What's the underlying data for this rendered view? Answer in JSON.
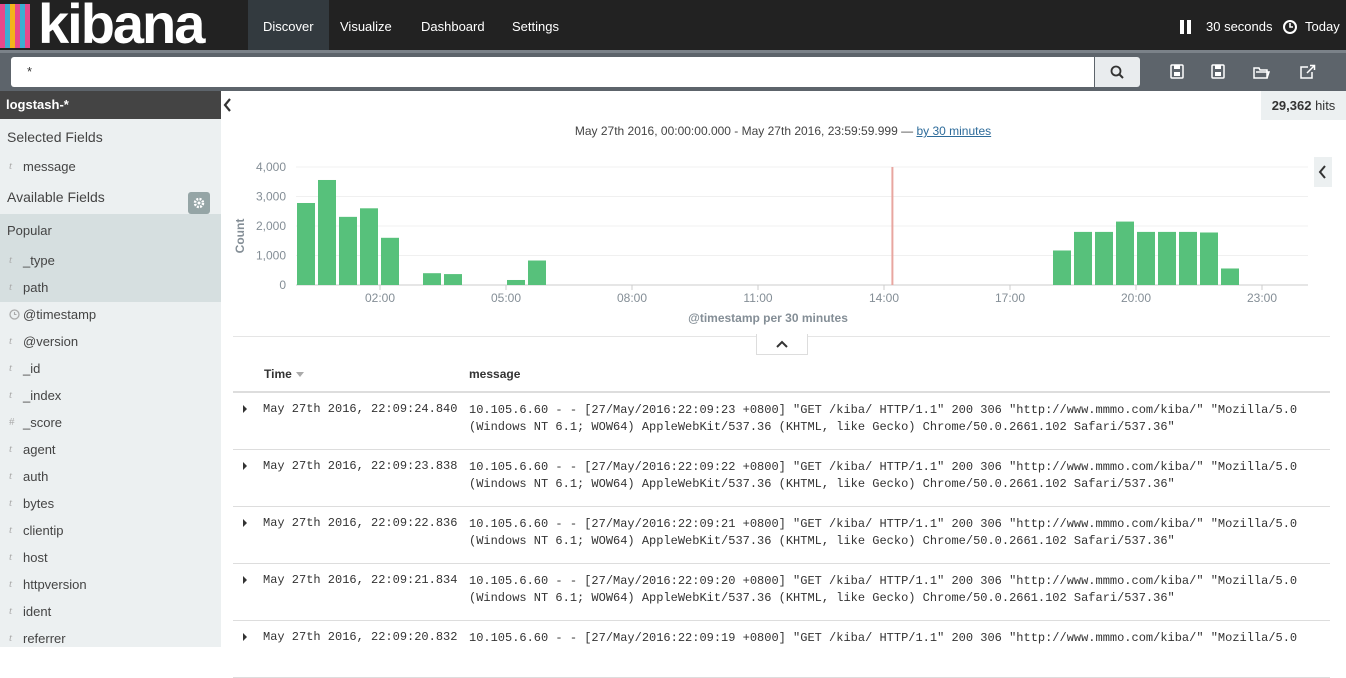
{
  "app": {
    "name": "kibana"
  },
  "nav": {
    "tabs": [
      {
        "label": "Discover",
        "active": true
      },
      {
        "label": "Visualize",
        "active": false
      },
      {
        "label": "Dashboard",
        "active": false
      },
      {
        "label": "Settings",
        "active": false
      }
    ],
    "refresh_interval": "30 seconds",
    "time_range": "Today"
  },
  "search": {
    "query": "*"
  },
  "sidebar": {
    "index_pattern": "logstash-*",
    "selected_title": "Selected Fields",
    "selected_fields": [
      {
        "type": "t",
        "name": "message"
      }
    ],
    "available_title": "Available Fields",
    "popular_title": "Popular",
    "popular_fields": [
      {
        "type": "t",
        "name": "_type"
      },
      {
        "type": "t",
        "name": "path"
      }
    ],
    "fields": [
      {
        "type": "clock",
        "name": "@timestamp"
      },
      {
        "type": "t",
        "name": "@version"
      },
      {
        "type": "t",
        "name": "_id"
      },
      {
        "type": "t",
        "name": "_index"
      },
      {
        "type": "#",
        "name": "_score"
      },
      {
        "type": "t",
        "name": "agent"
      },
      {
        "type": "t",
        "name": "auth"
      },
      {
        "type": "t",
        "name": "bytes"
      },
      {
        "type": "t",
        "name": "clientip"
      },
      {
        "type": "t",
        "name": "host"
      },
      {
        "type": "t",
        "name": "httpversion"
      },
      {
        "type": "t",
        "name": "ident"
      },
      {
        "type": "t",
        "name": "referrer"
      }
    ]
  },
  "hits": {
    "count": "29,362",
    "label": "hits"
  },
  "date_range": {
    "text": "May 27th 2016, 00:00:00.000 - May 27th 2016, 23:59:59.999 —",
    "interval_link": "by 30 minutes"
  },
  "chart_data": {
    "type": "bar",
    "ylabel": "Count",
    "xlabel": "@timestamp per 30 minutes",
    "ylim": [
      0,
      4000
    ],
    "y_ticks": [
      "0",
      "1,000",
      "2,000",
      "3,000",
      "4,000"
    ],
    "x_ticks": [
      {
        "label": "02:00",
        "hour": 2
      },
      {
        "label": "05:00",
        "hour": 5
      },
      {
        "label": "08:00",
        "hour": 8
      },
      {
        "label": "11:00",
        "hour": 11
      },
      {
        "label": "14:00",
        "hour": 14
      },
      {
        "label": "17:00",
        "hour": 17
      },
      {
        "label": "20:00",
        "hour": 20
      },
      {
        "label": "23:00",
        "hour": 23
      }
    ],
    "bar_color": "#57c17b",
    "marker_color": "#e8a6a0",
    "current_time_hour": 14.2,
    "bars": [
      {
        "start_hour": 0.0,
        "value": 2780
      },
      {
        "start_hour": 0.5,
        "value": 3560
      },
      {
        "start_hour": 1.0,
        "value": 2310
      },
      {
        "start_hour": 1.5,
        "value": 2600
      },
      {
        "start_hour": 2.0,
        "value": 1600
      },
      {
        "start_hour": 3.0,
        "value": 400
      },
      {
        "start_hour": 3.5,
        "value": 370
      },
      {
        "start_hour": 5.0,
        "value": 170
      },
      {
        "start_hour": 5.5,
        "value": 830
      },
      {
        "start_hour": 18.0,
        "value": 1170
      },
      {
        "start_hour": 18.5,
        "value": 1800
      },
      {
        "start_hour": 19.0,
        "value": 1800
      },
      {
        "start_hour": 19.5,
        "value": 2150
      },
      {
        "start_hour": 20.0,
        "value": 1800
      },
      {
        "start_hour": 20.5,
        "value": 1800
      },
      {
        "start_hour": 21.0,
        "value": 1800
      },
      {
        "start_hour": 21.5,
        "value": 1780
      },
      {
        "start_hour": 22.0,
        "value": 560
      }
    ]
  },
  "table": {
    "columns": [
      "Time",
      "message"
    ],
    "rows": [
      {
        "time": "May 27th 2016, 22:09:24.840",
        "message": "10.105.6.60 - - [27/May/2016:22:09:23 +0800] \"GET /kiba/ HTTP/1.1\" 200 306 \"http://www.mmmo.com/kiba/\" \"Mozilla/5.0 (Windows NT 6.1; WOW64) AppleWebKit/537.36 (KHTML, like Gecko) Chrome/50.0.2661.102 Safari/537.36\""
      },
      {
        "time": "May 27th 2016, 22:09:23.838",
        "message": "10.105.6.60 - - [27/May/2016:22:09:22 +0800] \"GET /kiba/ HTTP/1.1\" 200 306 \"http://www.mmmo.com/kiba/\" \"Mozilla/5.0 (Windows NT 6.1; WOW64) AppleWebKit/537.36 (KHTML, like Gecko) Chrome/50.0.2661.102 Safari/537.36\""
      },
      {
        "time": "May 27th 2016, 22:09:22.836",
        "message": "10.105.6.60 - - [27/May/2016:22:09:21 +0800] \"GET /kiba/ HTTP/1.1\" 200 306 \"http://www.mmmo.com/kiba/\" \"Mozilla/5.0 (Windows NT 6.1; WOW64) AppleWebKit/537.36 (KHTML, like Gecko) Chrome/50.0.2661.102 Safari/537.36\""
      },
      {
        "time": "May 27th 2016, 22:09:21.834",
        "message": "10.105.6.60 - - [27/May/2016:22:09:20 +0800] \"GET /kiba/ HTTP/1.1\" 200 306 \"http://www.mmmo.com/kiba/\" \"Mozilla/5.0 (Windows NT 6.1; WOW64) AppleWebKit/537.36 (KHTML, like Gecko) Chrome/50.0.2661.102 Safari/537.36\""
      },
      {
        "time": "May 27th 2016, 22:09:20.832",
        "message": "10.105.6.60 - - [27/May/2016:22:09:19 +0800] \"GET /kiba/ HTTP/1.1\" 200 306 \"http://www.mmmo.com/kiba/\" \"Mozilla/5.0"
      }
    ]
  }
}
